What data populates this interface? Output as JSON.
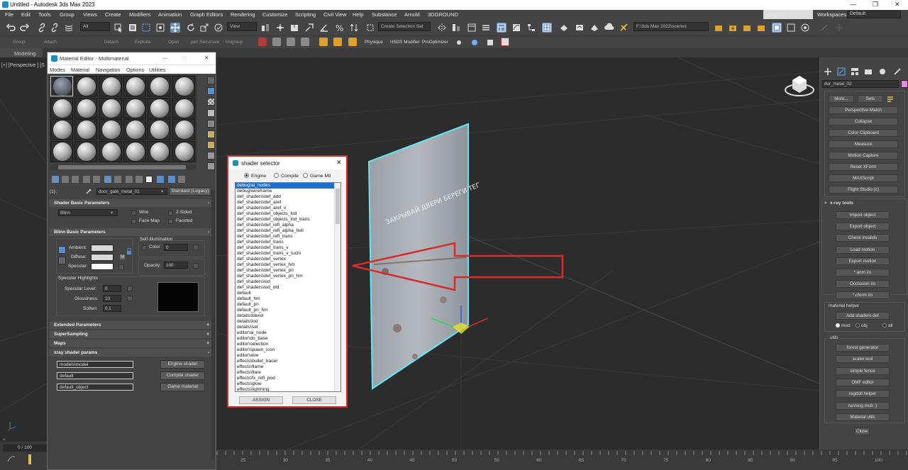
{
  "window_title": "Untitled - Autodesk 3ds Max 2023",
  "menu": [
    "File",
    "Edit",
    "Tools",
    "Group",
    "Views",
    "Create",
    "Modifiers",
    "Animation",
    "Graph Editors",
    "Rendering",
    "Customize",
    "Scripting",
    "Civil View",
    "Help",
    "Substance",
    "Arnold",
    "3DGROUND"
  ],
  "sign_in": "Sign In",
  "workspaces_label": "Workspaces:",
  "workspace_value": "Default",
  "toolbar": {
    "filter": "All",
    "ref_coord": "View",
    "selection_set": "Create Selection Set",
    "project_path": "F:\\3ds Max 2022\\scenes"
  },
  "toolbar2": [
    "Group",
    "Attach",
    "Detach",
    "Explode",
    "Open",
    "pen Recursive",
    "Ungroup",
    "Physique",
    "HSDS Modifier",
    "ProOptimizer"
  ],
  "ribbon_tab": "Modeling",
  "viewport_label": "[+] [Perspective ] [S",
  "frame_counter": "0 / 100",
  "timeline_ticks": [
    "25",
    "30",
    "35",
    "40",
    "45",
    "50",
    "55",
    "60",
    "65",
    "70",
    "75",
    "80",
    "85",
    "90",
    "95",
    "100"
  ],
  "material_editor": {
    "title": "Material Editor - Multimaterial",
    "menu": [
      "Modes",
      "Material",
      "Navigation",
      "Options",
      "Utilities"
    ],
    "slot_label": "(1) :",
    "material_name": "door_gate_metal_01",
    "material_type": "Standard (Legacy)",
    "rollouts": {
      "shader_basic": "Shader Basic Parameters",
      "blinn_basic": "Blinn Basic Parameters",
      "extended": "Extended Parameters",
      "supersampling": "SuperSampling",
      "maps": "Maps",
      "xray": "xray shader params"
    },
    "shader": "Blinn",
    "checks": {
      "wire": "Wire",
      "two_sided": "2-Sided",
      "face_map": "Face Map",
      "faceted": "Faceted"
    },
    "self_illum_label": "Self-Illumination",
    "color_label": "Color",
    "color_value": "0",
    "opacity_label": "Opacity:",
    "opacity_value": "100",
    "ambient": "Ambient:",
    "diffuse": "Diffuse:",
    "specular": "Specular:",
    "lock_m": "M",
    "specular_highlights": "Specular Highlights",
    "spec_level_label": "Specular Level:",
    "spec_level": "0",
    "gloss_label": "Glossiness:",
    "gloss": "10",
    "soften_label": "Soften:",
    "soften": "0,1",
    "xray_fields": [
      {
        "value": "models\\model",
        "button": "Engine shader"
      },
      {
        "value": "default",
        "button": "Compile shader"
      },
      {
        "value": "default_object",
        "button": "Game material"
      }
    ]
  },
  "shader_selector": {
    "title": "shader selector",
    "radios": [
      {
        "label": "Engine",
        "on": true
      },
      {
        "label": "Compile",
        "on": false
      },
      {
        "label": "Game Mtl",
        "on": false
      }
    ],
    "items": [
      "debug\\ai_nodes",
      "debug\\wireframe",
      "def_shaders\\def_add",
      "def_shaders\\def_aref",
      "def_shaders\\def_aref_v",
      "def_shaders\\def_objects_lod",
      "def_shaders\\def_objects_lod_trans",
      "def_shaders\\def_refl_alpha",
      "def_shaders\\def_refl_alpha_heli",
      "def_shaders\\def_refl_trans",
      "def_shaders\\def_trans",
      "def_shaders\\def_trans_v",
      "def_shaders\\def_trans_v_tuchi",
      "def_shaders\\def_vertex",
      "def_shaders\\def_vertex_hm",
      "def_shaders\\def_vertex_pn",
      "def_shaders\\def_vertex_pn_hm",
      "def_shaders\\lod",
      "def_shaders\\lod_old",
      "default",
      "default_hm",
      "default_pn",
      "default_pn_hm",
      "details\\blend",
      "details\\lod",
      "details\\set",
      "editor\\ai_node",
      "editor\\do_base",
      "editor\\selection",
      "editor\\spawn_icon",
      "editor\\wire",
      "effects\\bullet_tracer",
      "effects\\flame",
      "effects\\flare",
      "effects\\fx_refl_pod",
      "effects\\glow",
      "effects\\lightning"
    ],
    "assign": "ASSIGN",
    "close": "CLOSE"
  },
  "door_text": "ЗАКРЫВАЙ ДВЕРИ БЕРЕГИ ТЕПЛО",
  "command_panel": {
    "object_name": "dor_metal_02",
    "more": "More...",
    "sets": "Sets",
    "utilities": [
      "Perspective Match",
      "Collapse",
      "Color Clipboard",
      "Measure",
      "Motion Capture",
      "Reset XForm",
      "MAXScript",
      "Flight Studio (c)"
    ],
    "xray_title": "x-ray tools",
    "xray_buttons": [
      "Import object",
      "Export object",
      "Check invalids",
      "Load motion",
      "Export motion",
      "*.anm i/o",
      "Occlusion i/o",
      "*.cform i/o"
    ],
    "material_helper": "material helper",
    "add_shaders": "Add shaders def",
    "radio_opts": [
      "med",
      "obj",
      "all"
    ],
    "utils_label": "utils",
    "utils_buttons": [
      "forest generator",
      "scaler tool",
      "simple fence",
      "OMF editor",
      "ragdoll helper",
      "running mob :)",
      "Material utils"
    ],
    "close": "Close"
  },
  "colors": {
    "accent": "#1e6fd4",
    "highlight_frame": "#d92b2b",
    "selection_cyan": "#5fe8f5"
  }
}
